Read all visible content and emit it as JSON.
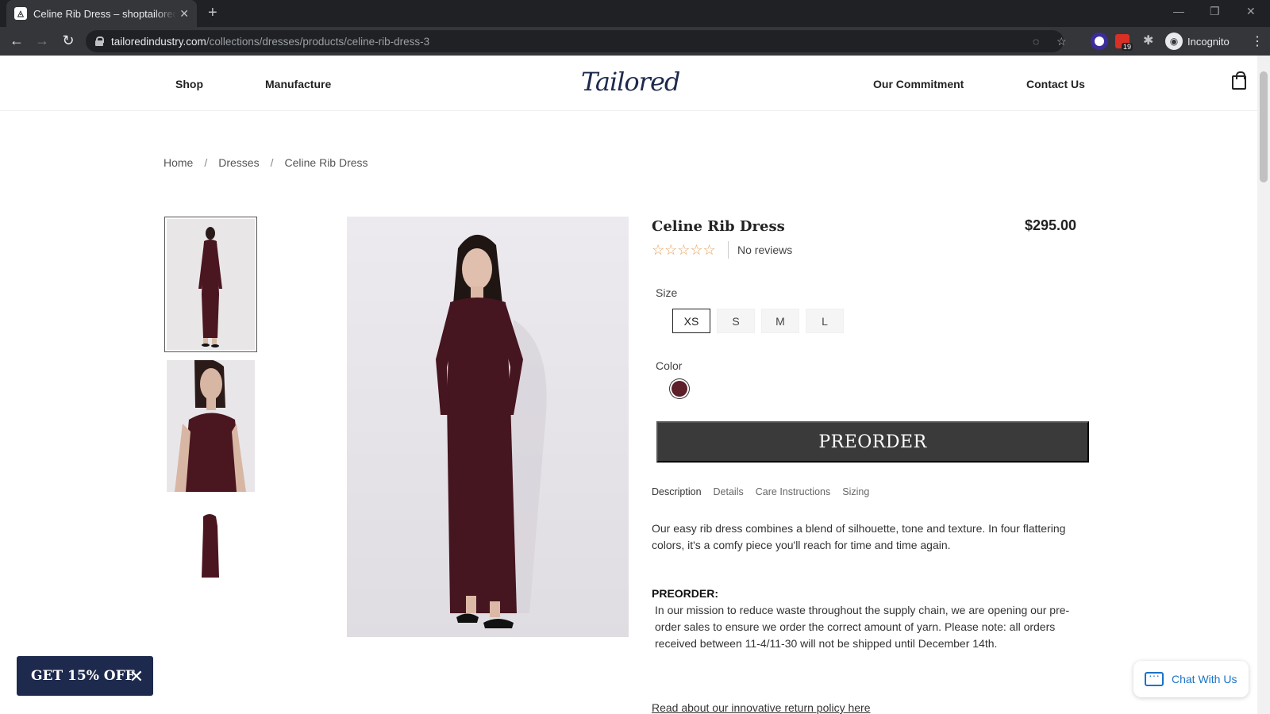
{
  "browser": {
    "tab_title": "Celine Rib Dress – shoptailoredindustry",
    "url_host": "tailoredindustry.com",
    "url_path": "/collections/dresses/products/celine-rib-dress-3",
    "incognito_label": "Incognito",
    "ext_badge": "19"
  },
  "header": {
    "nav_left": [
      "Shop",
      "Manufacture"
    ],
    "logo": "Tailored",
    "nav_right": [
      "Our Commitment",
      "Contact Us"
    ]
  },
  "breadcrumb": {
    "items": [
      "Home",
      "Dresses",
      "Celine Rib Dress"
    ],
    "separator": "/"
  },
  "product": {
    "title": "Celine Rib Dress",
    "price": "$295.00",
    "stars": "☆☆☆☆☆",
    "reviews": "No reviews",
    "size_label": "Size",
    "sizes": [
      "XS",
      "S",
      "M",
      "L"
    ],
    "selected_size": "XS",
    "color_label": "Color",
    "color_swatch": "#5d1f2a",
    "cta": "PREORDER",
    "tabs": [
      "Description",
      "Details",
      "Care Instructions",
      "Sizing"
    ],
    "active_tab": "Description",
    "description": "Our easy rib dress combines a blend of silhouette, tone and texture. In four flattering colors, it's a comfy piece you'll reach for time and time again.",
    "preorder_heading": "PREORDER:",
    "preorder_text": "In our mission to reduce waste throughout the supply chain, we are opening our pre-order sales to ensure we order the correct amount of yarn. Please note: all orders received between 11-4/11-30 will not be shipped until December 14th.",
    "return_link": "Read about our innovative return policy here"
  },
  "promo": {
    "label": "GET 15% OFF",
    "close": "✕"
  },
  "chat": {
    "label": "Chat With Us"
  },
  "colors": {
    "brand_navy": "#1d2a4d",
    "cta_bg": "#3a3a3a",
    "star": "#e9a15d",
    "chat_blue": "#1a73c8"
  }
}
